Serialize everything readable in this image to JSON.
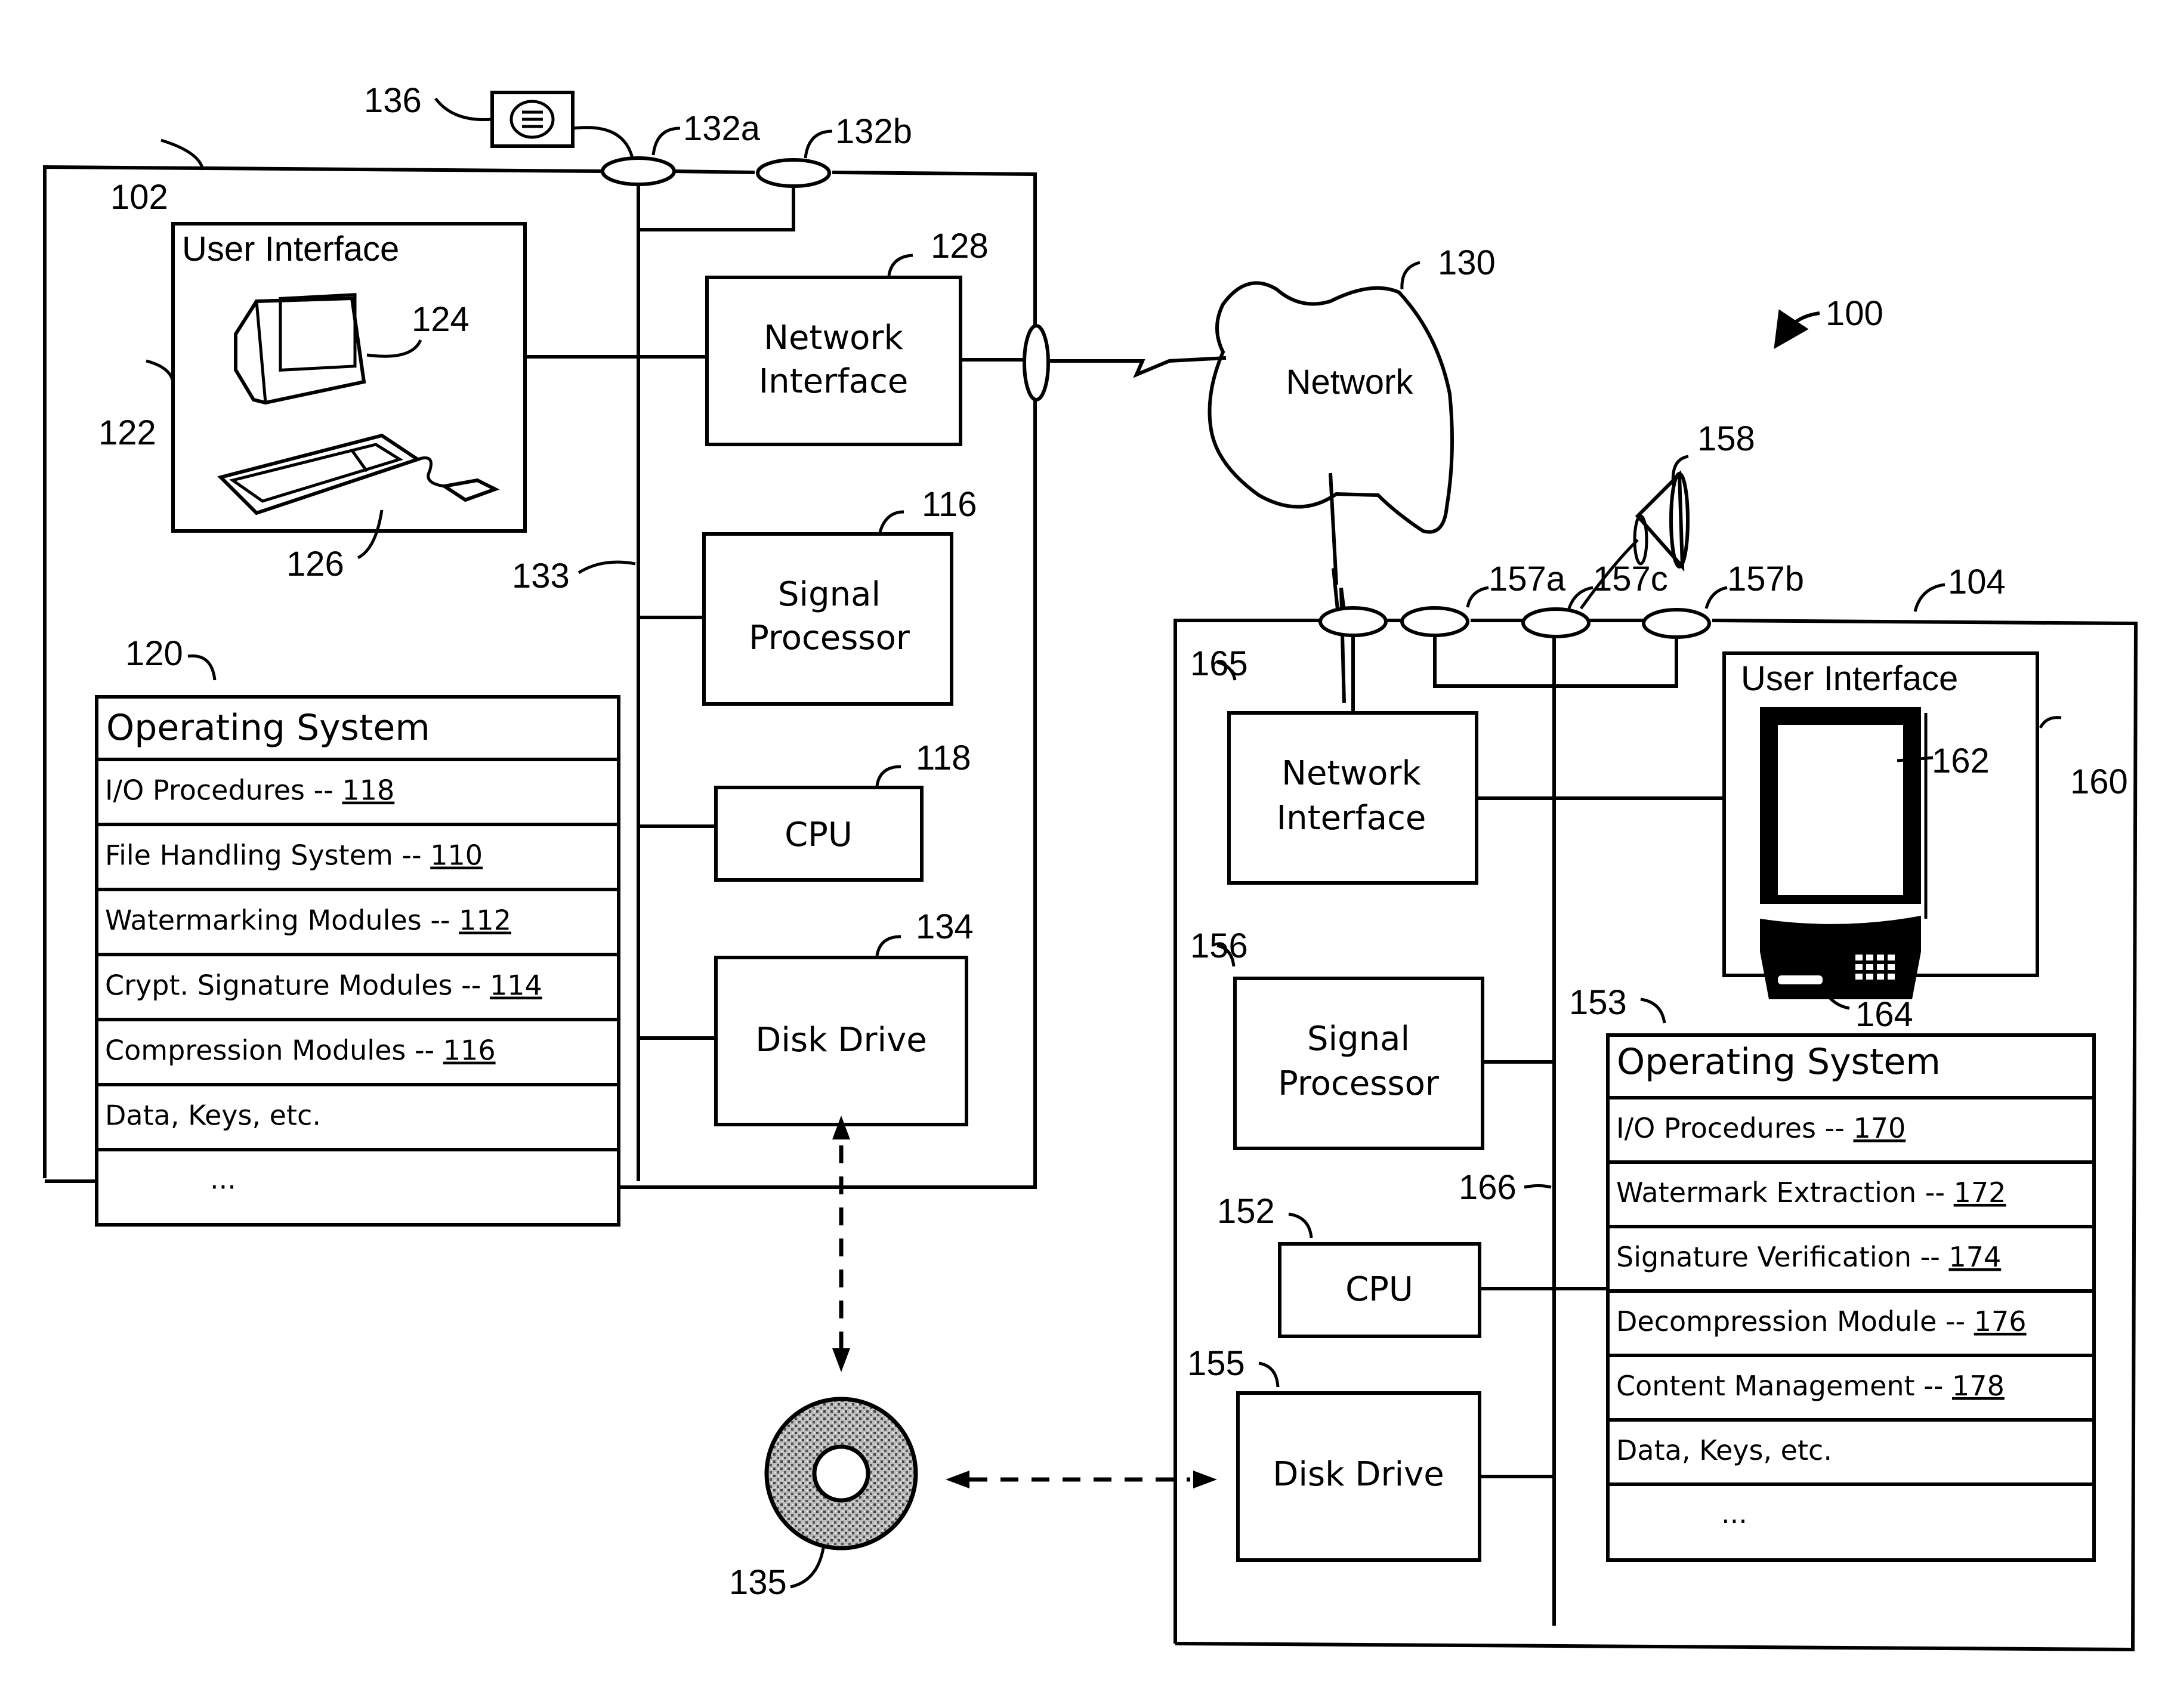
{
  "figure_ref": "100",
  "left_device": {
    "ref": "102",
    "ui_ref": "122",
    "ui_label": "User Interface",
    "monitor_ref": "124",
    "keyboard_ref": "126",
    "bus_ref": "133",
    "port_a_ref": "132a",
    "port_b_ref": "132b",
    "peripheral_ref": "136",
    "network_interface": {
      "ref": "128",
      "line1": "Network",
      "line2": "Interface"
    },
    "signal_processor": {
      "ref": "116",
      "line1": "Signal",
      "line2": "Processor"
    },
    "cpu": {
      "ref": "118",
      "label": "CPU"
    },
    "disk_drive": {
      "ref": "134",
      "label": "Disk Drive"
    },
    "os": {
      "ref": "120",
      "title": "Operating System",
      "rows": [
        {
          "text": "I/O Procedures -- ",
          "num": "118"
        },
        {
          "text": "File Handling System -- ",
          "num": "110"
        },
        {
          "text": "Watermarking Modules -- ",
          "num": "112"
        },
        {
          "text": "Crypt. Signature Modules -- ",
          "num": "114"
        },
        {
          "text": "Compression Modules -- ",
          "num": "116"
        },
        {
          "text": "Data, Keys, etc.",
          "num": ""
        },
        {
          "text": "...",
          "num": ""
        }
      ]
    }
  },
  "network": {
    "ref": "130",
    "label": "Network"
  },
  "media": {
    "ref": "135"
  },
  "right_device": {
    "ref": "104",
    "ui_ref": "160",
    "ui_label": "User Interface",
    "screen_ref": "162",
    "button_ref": "164",
    "bus_ref": "166",
    "port_a_ref": "157a",
    "port_c_ref": "157c",
    "port_b_ref": "157b",
    "peripheral_ref": "158",
    "network_interface": {
      "ref": "165",
      "line1": "Network",
      "line2": "Interface"
    },
    "signal_processor": {
      "ref": "156",
      "line1": "Signal",
      "line2": "Processor"
    },
    "cpu": {
      "ref": "152",
      "label": "CPU"
    },
    "disk_drive": {
      "ref": "155",
      "label": "Disk Drive"
    },
    "os": {
      "ref": "153",
      "title": "Operating System",
      "rows": [
        {
          "text": "I/O Procedures -- ",
          "num": "170"
        },
        {
          "text": "Watermark Extraction -- ",
          "num": "172"
        },
        {
          "text": "Signature Verification -- ",
          "num": "174"
        },
        {
          "text": "Decompression Module -- ",
          "num": "176"
        },
        {
          "text": "Content Management -- ",
          "num": "178"
        },
        {
          "text": "Data, Keys, etc.",
          "num": ""
        },
        {
          "text": "...",
          "num": ""
        }
      ]
    }
  }
}
